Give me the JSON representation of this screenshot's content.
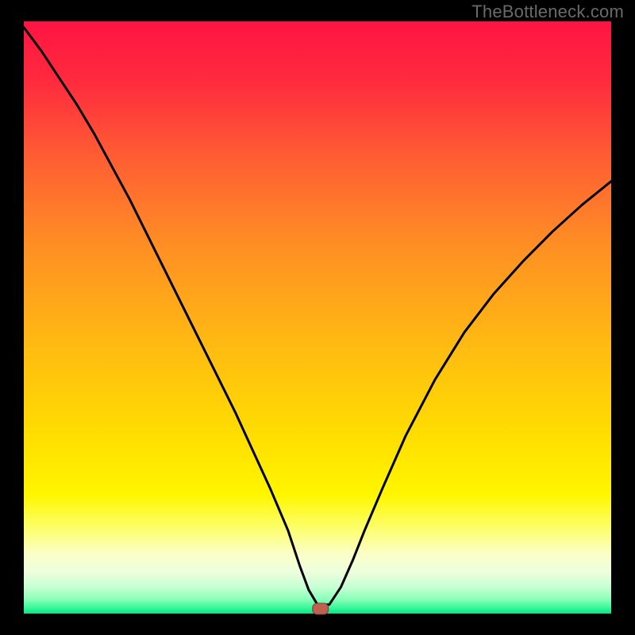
{
  "watermark": "TheBottleneck.com",
  "chart_data": {
    "type": "line",
    "title": "",
    "xlabel": "",
    "ylabel": "",
    "xlim": [
      0,
      100
    ],
    "ylim": [
      0,
      100
    ],
    "axes_visible": false,
    "grid": false,
    "background_gradient": {
      "top_color": "#ff1541",
      "mid_color": "#ffde00",
      "bottom_colors": [
        "#fffde0",
        "#e7ffde",
        "#b8ffcc",
        "#58ffa2",
        "#00e885"
      ]
    },
    "series": [
      {
        "name": "bottleneck-curve",
        "color": "#000000",
        "x": [
          0,
          3,
          6,
          9,
          12,
          15,
          18,
          21,
          24,
          27,
          30,
          33,
          36,
          39,
          42,
          45,
          47,
          48.5,
          50,
          52,
          54,
          56,
          58,
          61,
          65,
          70,
          75,
          80,
          85,
          90,
          95,
          100
        ],
        "y": [
          99,
          95,
          90.5,
          86,
          81,
          75.5,
          70,
          64,
          58,
          52,
          46,
          40,
          34,
          27.5,
          21,
          14,
          8,
          4,
          1.5,
          1.5,
          4.5,
          9,
          14,
          21,
          30,
          39.5,
          47.5,
          54,
          59.5,
          64.5,
          69,
          73
        ]
      }
    ],
    "marker": {
      "name": "optimal-point",
      "x": 50.5,
      "y": 0.8,
      "color": "#c06050",
      "shape": "rounded-rect"
    }
  }
}
